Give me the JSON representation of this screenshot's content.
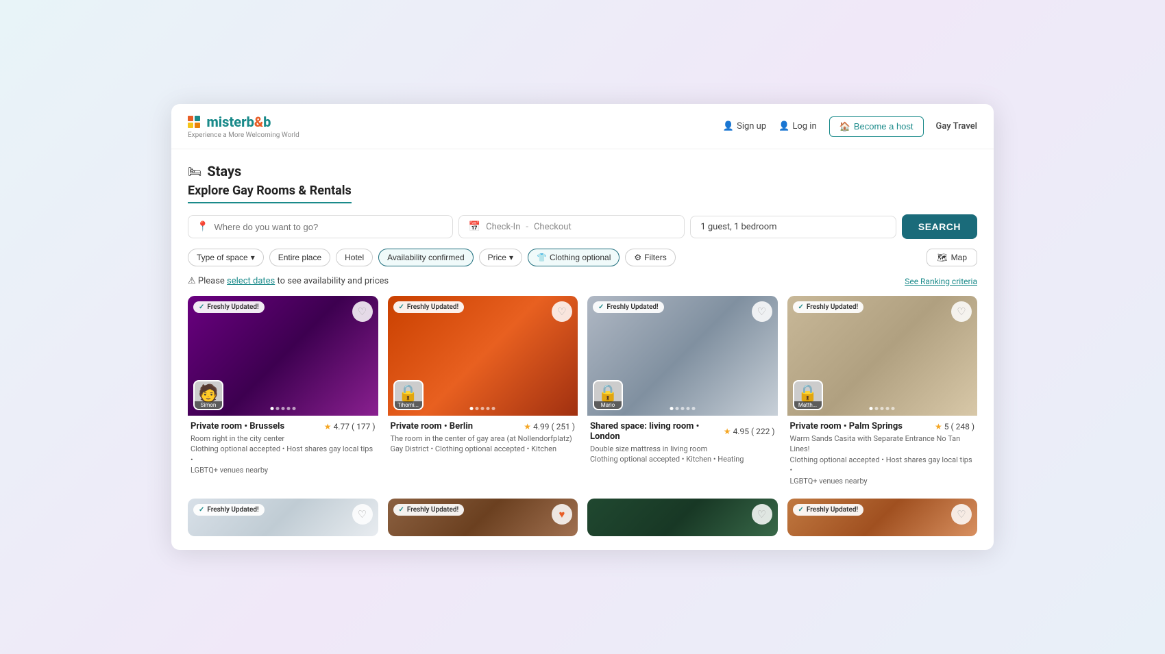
{
  "header": {
    "logo_brand": "misterb",
    "logo_ampersand": "&",
    "logo_b": "b",
    "logo_tagline": "Experience a More Welcoming World",
    "nav": {
      "signup": "Sign up",
      "login": "Log in",
      "become_host": "Become a host",
      "gay_travel": "Gay Travel"
    }
  },
  "page": {
    "stays_label": "Stays",
    "section_title": "Explore Gay Rooms & Rentals"
  },
  "search": {
    "location_placeholder": "Where do you want to go?",
    "checkin_label": "Check-In",
    "checkout_label": "Checkout",
    "guests_label": "1 guest, 1 bedroom",
    "search_button": "SEARCH"
  },
  "filters": {
    "type_space": "Type of space",
    "entire_place": "Entire place",
    "hotel": "Hotel",
    "availability": "Availability confirmed",
    "price": "Price",
    "clothing_optional": "Clothing optional",
    "filters": "Filters",
    "map": "Map"
  },
  "alert": {
    "prefix": "⚠ Please",
    "link_text": "select dates",
    "suffix": "to see availability and prices",
    "ranking_link": "See Ranking criteria"
  },
  "listings": [
    {
      "id": 1,
      "badge": "Freshly Updated!",
      "heart_active": false,
      "host_name": "Simon",
      "title": "Private room • Brussels",
      "rating": "4.77",
      "reviews": "177",
      "desc_line1": "Room right in the city center",
      "desc_line2": "Clothing optional accepted • Host shares gay local tips •",
      "desc_line3": "LGBTQ+ venues nearby",
      "img_class": "img-purple"
    },
    {
      "id": 2,
      "badge": "Freshly Updated!",
      "heart_active": false,
      "host_name": "Tihomi...",
      "title": "Private room • Berlin",
      "rating": "4.99",
      "reviews": "251",
      "desc_line1": "The room in the center of gay area (at Nollendorfplatz)",
      "desc_line2": "Gay District • Clothing optional accepted • Kitchen",
      "desc_line3": "",
      "img_class": "img-orange"
    },
    {
      "id": 3,
      "badge": "Freshly Updated!",
      "heart_active": false,
      "host_name": "Mario",
      "title": "Shared space: living room • London",
      "rating": "4.95",
      "reviews": "222",
      "desc_line1": "Double size mattress in living room",
      "desc_line2": "Clothing optional accepted • Kitchen • Heating",
      "desc_line3": "",
      "img_class": "img-gray"
    },
    {
      "id": 4,
      "badge": "Freshly Updated!",
      "heart_active": false,
      "host_name": "Matth...",
      "title": "Private room • Palm Springs",
      "rating": "5",
      "reviews": "248",
      "desc_line1": "Warm Sands Casita with Separate Entrance No Tan Lines!",
      "desc_line2": "Clothing optional accepted • Host shares gay local tips •",
      "desc_line3": "LGBTQ+ venues nearby",
      "img_class": "img-beige"
    }
  ],
  "bottom_listings": [
    {
      "id": 5,
      "badge": "Freshly Updated!",
      "img_class": "img-light"
    },
    {
      "id": 6,
      "badge": "Freshly Updated!",
      "img_class": "img-brown"
    },
    {
      "id": 7,
      "badge": "",
      "img_class": "img-green"
    },
    {
      "id": 8,
      "badge": "Freshly Updated!",
      "img_class": "img-warm"
    }
  ]
}
